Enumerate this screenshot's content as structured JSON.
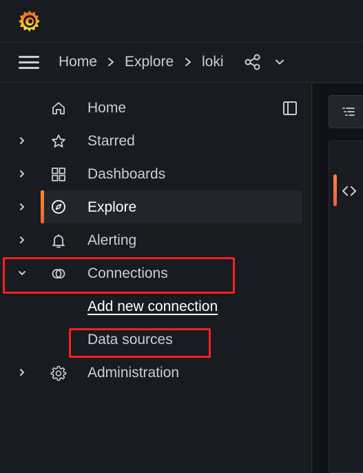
{
  "breadcrumb": {
    "items": [
      "Home",
      "Explore",
      "loki"
    ]
  },
  "sidebar": {
    "items": [
      {
        "label": "Home",
        "icon": "home-icon",
        "expandable": false
      },
      {
        "label": "Starred",
        "icon": "star-icon",
        "expandable": true
      },
      {
        "label": "Dashboards",
        "icon": "apps-icon",
        "expandable": true
      },
      {
        "label": "Explore",
        "icon": "compass-icon",
        "expandable": true,
        "active": true
      },
      {
        "label": "Alerting",
        "icon": "bell-icon",
        "expandable": true
      },
      {
        "label": "Connections",
        "icon": "connections-icon",
        "expandable": true,
        "expanded": true
      },
      {
        "label": "Administration",
        "icon": "cog-icon",
        "expandable": true
      }
    ],
    "connections_children": [
      "Add new connection",
      "Data sources"
    ]
  },
  "colors": {
    "background": "#181b1f",
    "text": "#ccccdc",
    "accent": "#f55f3e",
    "annotation": "#ff1f1f"
  }
}
